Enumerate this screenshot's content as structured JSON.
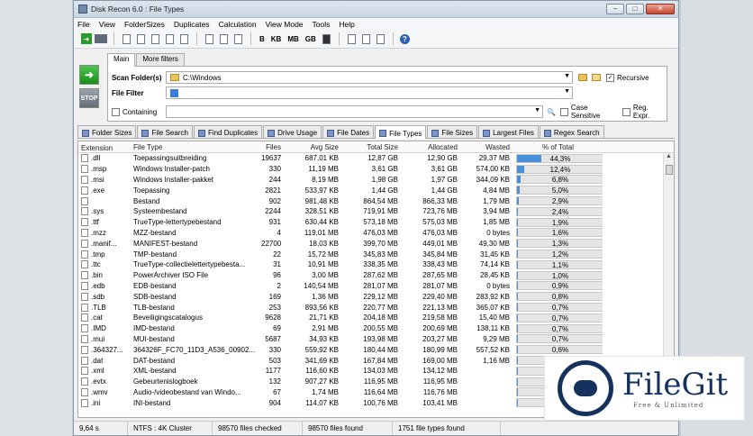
{
  "window": {
    "title": "Disk Recon 6.0 : File Types"
  },
  "menu": [
    "File",
    "View",
    "FolderSizes",
    "Duplicates",
    "Calculation",
    "View Mode",
    "Tools",
    "Help"
  ],
  "toolbar": {
    "units": [
      "B",
      "KB",
      "MB",
      "GB"
    ]
  },
  "side": {
    "stop_label": "STOP"
  },
  "scan": {
    "tabs": [
      "Main",
      "More filters"
    ],
    "scan_label": "Scan Folder(s)",
    "scan_value": "C:\\Windows",
    "recursive_label": "Recursive",
    "recursive_checked": true,
    "filter_label": "File Filter",
    "filter_value": "",
    "containing_label": "Containing",
    "containing_value": "",
    "case_label": "Case Sensitive",
    "regex_label": "Reg. Expr."
  },
  "tabs": [
    "Folder Sizes",
    "File Search",
    "Find Duplicates",
    "Drive Usage",
    "File Dates",
    "File Types",
    "File Sizes",
    "Largest Files",
    "Regex Search"
  ],
  "active_tab": "File Types",
  "columns": [
    "Extension",
    "File Type",
    "Files",
    "Avg Size",
    "Total Size",
    "Allocated",
    "Wasted",
    "% of Total"
  ],
  "rows": [
    {
      "ext": ".dll",
      "type": "Toepassingsuitbreiding",
      "files": "19637",
      "avg": "687,01 KB",
      "total": "12,87 GB",
      "alloc": "12,90 GB",
      "wasted": "29,37 MB",
      "pct": "44,3%",
      "pv": 44.3
    },
    {
      "ext": ".msp",
      "type": "Windows Installer-patch",
      "files": "330",
      "avg": "11,19 MB",
      "total": "3,61 GB",
      "alloc": "3,61 GB",
      "wasted": "574,00 KB",
      "pct": "12,4%",
      "pv": 12.4
    },
    {
      "ext": ".msi",
      "type": "Windows Installer-pakket",
      "files": "244",
      "avg": "8,19 MB",
      "total": "1,98 GB",
      "alloc": "1,97 GB",
      "wasted": "344,09 KB",
      "pct": "6,8%",
      "pv": 6.8
    },
    {
      "ext": ".exe",
      "type": "Toepassing",
      "files": "2821",
      "avg": "533,97 KB",
      "total": "1,44 GB",
      "alloc": "1,44 GB",
      "wasted": "4,84 MB",
      "pct": "5,0%",
      "pv": 5.0
    },
    {
      "ext": "",
      "type": "Bestand",
      "files": "902",
      "avg": "981,48 KB",
      "total": "864,54 MB",
      "alloc": "866,33 MB",
      "wasted": "1,79 MB",
      "pct": "2,9%",
      "pv": 2.9
    },
    {
      "ext": ".sys",
      "type": "Systeembestand",
      "files": "2244",
      "avg": "328,51 KB",
      "total": "719,91 MB",
      "alloc": "723,76 MB",
      "wasted": "3,94 MB",
      "pct": "2,4%",
      "pv": 2.4
    },
    {
      "ext": ".ttf",
      "type": "TrueType-lettertypebestand",
      "files": "931",
      "avg": "630,44 KB",
      "total": "573,18 MB",
      "alloc": "575,03 MB",
      "wasted": "1,85 MB",
      "pct": "1,9%",
      "pv": 1.9
    },
    {
      "ext": ".mzz",
      "type": "MZZ-bestand",
      "files": "4",
      "avg": "119,01 MB",
      "total": "476,03 MB",
      "alloc": "476,03 MB",
      "wasted": "0 bytes",
      "pct": "1,6%",
      "pv": 1.6
    },
    {
      "ext": ".manif...",
      "type": "MANIFEST-bestand",
      "files": "22700",
      "avg": "18,03 KB",
      "total": "399,70 MB",
      "alloc": "449,01 MB",
      "wasted": "49,30 MB",
      "pct": "1,3%",
      "pv": 1.3
    },
    {
      "ext": ".tmp",
      "type": "TMP-bestand",
      "files": "22",
      "avg": "15,72 MB",
      "total": "345,83 MB",
      "alloc": "345,84 MB",
      "wasted": "31,45 KB",
      "pct": "1,2%",
      "pv": 1.2
    },
    {
      "ext": ".ttc",
      "type": "TrueType-collectielettertypebesta...",
      "files": "31",
      "avg": "10,91 MB",
      "total": "338,35 MB",
      "alloc": "338,43 MB",
      "wasted": "74,14 KB",
      "pct": "1,1%",
      "pv": 1.1
    },
    {
      "ext": ".bin",
      "type": "PowerArchiver ISO File",
      "files": "96",
      "avg": "3,00 MB",
      "total": "287,62 MB",
      "alloc": "287,65 MB",
      "wasted": "28,45 KB",
      "pct": "1,0%",
      "pv": 1.0
    },
    {
      "ext": ".edb",
      "type": "EDB-bestand",
      "files": "2",
      "avg": "140,54 MB",
      "total": "281,07 MB",
      "alloc": "281,07 MB",
      "wasted": "0 bytes",
      "pct": "0,9%",
      "pv": 0.9
    },
    {
      "ext": ".sdb",
      "type": "SDB-bestand",
      "files": "169",
      "avg": "1,36 MB",
      "total": "229,12 MB",
      "alloc": "229,40 MB",
      "wasted": "283,92 KB",
      "pct": "0,8%",
      "pv": 0.8
    },
    {
      "ext": ".TLB",
      "type": "TLB-bestand",
      "files": "253",
      "avg": "893,56 KB",
      "total": "220,77 MB",
      "alloc": "221,13 MB",
      "wasted": "365,07 KB",
      "pct": "0,7%",
      "pv": 0.7
    },
    {
      "ext": ".cat",
      "type": "Beveiligingscatalogus",
      "files": "9628",
      "avg": "21,71 KB",
      "total": "204,18 MB",
      "alloc": "219,58 MB",
      "wasted": "15,40 MB",
      "pct": "0,7%",
      "pv": 0.7
    },
    {
      "ext": ".IMD",
      "type": "IMD-bestand",
      "files": "69",
      "avg": "2,91 MB",
      "total": "200,55 MB",
      "alloc": "200,69 MB",
      "wasted": "138,11 KB",
      "pct": "0,7%",
      "pv": 0.7
    },
    {
      "ext": ".mui",
      "type": "MUI-bestand",
      "files": "5687",
      "avg": "34,93 KB",
      "total": "193,98 MB",
      "alloc": "203,27 MB",
      "wasted": "9,29 MB",
      "pct": "0,7%",
      "pv": 0.7
    },
    {
      "ext": ".364327...",
      "type": "364326F_FC70_11D3_A536_00902...",
      "files": "330",
      "avg": "559,92 KB",
      "total": "180,44 MB",
      "alloc": "180,99 MB",
      "wasted": "557,52 KB",
      "pct": "0,6%",
      "pv": 0.6
    },
    {
      "ext": ".dat",
      "type": "DAT-bestand",
      "files": "503",
      "avg": "341,69 KB",
      "total": "167,84 MB",
      "alloc": "169,00 MB",
      "wasted": "1,16 MB",
      "pct": "0,6%",
      "pv": 0.6
    },
    {
      "ext": ".xml",
      "type": "XML-bestand",
      "files": "1177",
      "avg": "116,60 KB",
      "total": "134,03 MB",
      "alloc": "134,12 MB",
      "wasted": "",
      "pct": "",
      "pv": 0.5
    },
    {
      "ext": ".evtx",
      "type": "Gebeurtenislogboek",
      "files": "132",
      "avg": "907,27 KB",
      "total": "116,95 MB",
      "alloc": "116,95 MB",
      "wasted": "",
      "pct": "",
      "pv": 0.4
    },
    {
      "ext": ".wmv",
      "type": "Audio-/videobestand van Windo...",
      "files": "67",
      "avg": "1,74 MB",
      "total": "116,64 MB",
      "alloc": "116,76 MB",
      "wasted": "",
      "pct": "",
      "pv": 0.4
    },
    {
      "ext": ".ini",
      "type": "INI-bestand",
      "files": "904",
      "avg": "114,07 KB",
      "total": "100,76 MB",
      "alloc": "103,41 MB",
      "wasted": "",
      "pct": "",
      "pv": 0.4
    }
  ],
  "status": {
    "time": "9,64 s",
    "fs": "NTFS : 4K Cluster",
    "checked": "98570 files checked",
    "found": "98570 files found",
    "types": "1751 file types found"
  },
  "watermark": {
    "name": "FileGit",
    "tagline": "Free & Unlimited"
  }
}
